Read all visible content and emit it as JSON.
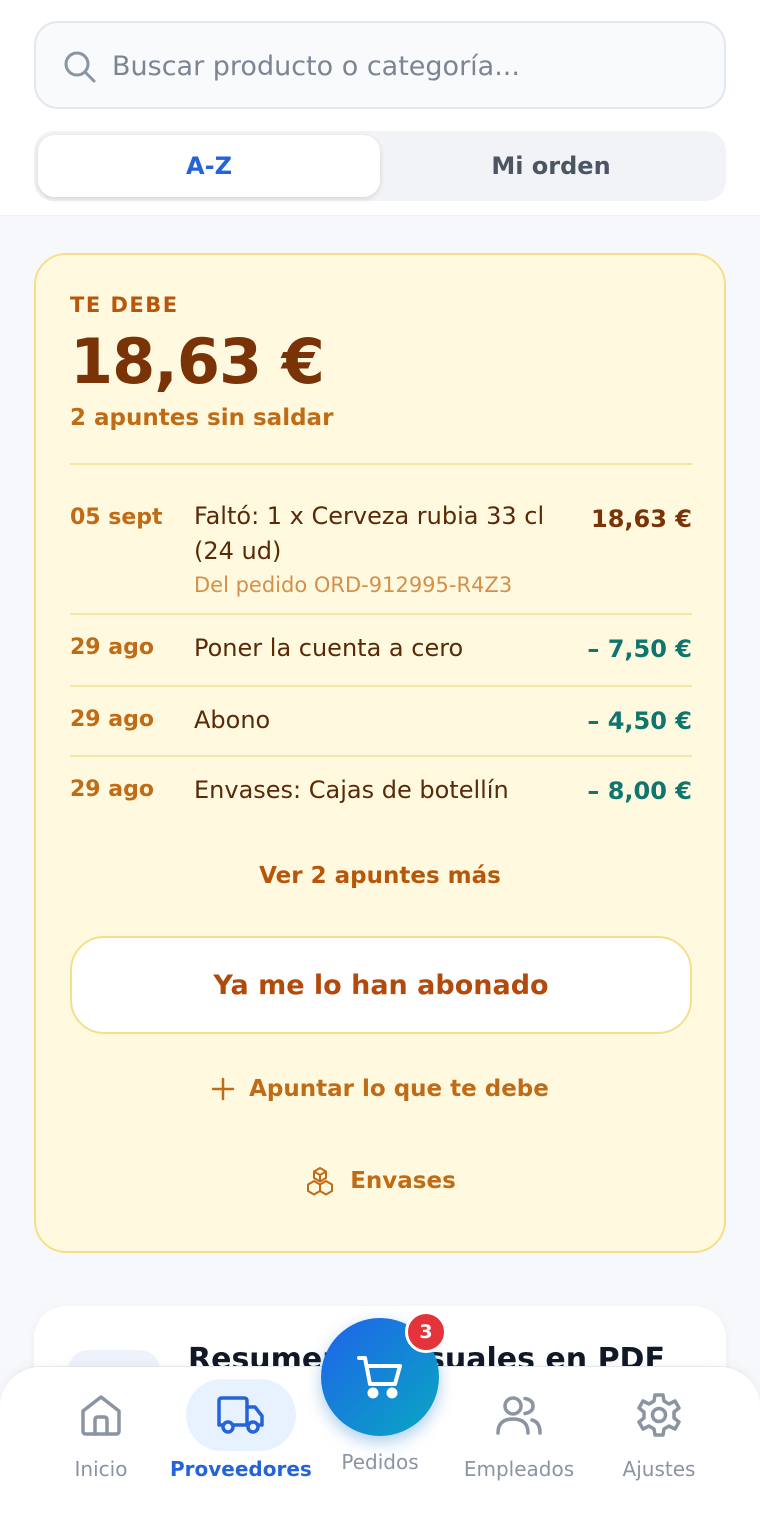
{
  "search": {
    "placeholder": "Buscar producto o categoría..."
  },
  "sort_tabs": [
    {
      "label": "A-Z",
      "active": true
    },
    {
      "label": "Mi orden",
      "active": false
    }
  ],
  "debt_card": {
    "label": "TE DEBE",
    "amount": "18,63 €",
    "subtitle": "2 apuntes sin saldar",
    "entries": [
      {
        "date": "05 sept",
        "description": "Faltó: 1 x Cerveza rubia 33 cl (24 ud)",
        "origin": "Del pedido ORD-912995-R4Z3",
        "amount": "18,63 €",
        "kind": "positive"
      },
      {
        "date": "29 ago",
        "description": "Poner la cuenta a cero",
        "amount": "– 7,50 €",
        "kind": "negative"
      },
      {
        "date": "29 ago",
        "description": "Abono",
        "amount": "– 4,50 €",
        "kind": "negative"
      },
      {
        "date": "29 ago",
        "description": "Envases: Cajas de botellín",
        "amount": "– 8,00 €",
        "kind": "negative"
      }
    ],
    "more_link": "Ver 2 apuntes más",
    "paid_button": "Ya me lo han abonado",
    "add_link": "Apuntar lo que te debe",
    "containers_link": "Envases"
  },
  "summary_card": {
    "title": "Resumen mensuales en PDF"
  },
  "bottom_nav": {
    "items": [
      {
        "label": "Inicio",
        "icon": "home-icon",
        "active": false
      },
      {
        "label": "Proveedores",
        "icon": "truck-icon",
        "active": true
      },
      {
        "label": "Pedidos",
        "icon": "cart-icon",
        "active": false
      },
      {
        "label": "Empleados",
        "icon": "users-icon",
        "active": false
      },
      {
        "label": "Ajustes",
        "icon": "gear-icon",
        "active": false
      }
    ],
    "cart_badge": "3"
  },
  "colors": {
    "primary": "#2563d9",
    "debt_bg": "#fff9e0",
    "debt_border": "#f6df8a",
    "debt_text": "#7a3307",
    "credit_text": "#0f766e",
    "badge": "#e5333c"
  }
}
